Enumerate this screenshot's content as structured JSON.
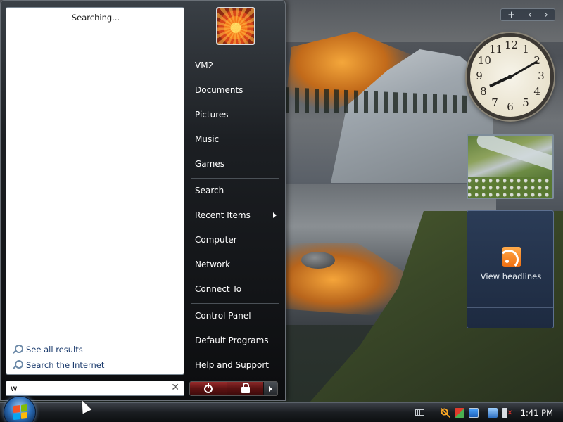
{
  "start_menu": {
    "search_status": "Searching...",
    "search_links": [
      {
        "label": "See all results",
        "icon": "search-icon"
      },
      {
        "label": "Search the Internet",
        "icon": "search-icon"
      }
    ],
    "search_query": "w",
    "user_picture": "flower-user-picture",
    "right_items": [
      {
        "label": "VM2"
      },
      {
        "label": "Documents"
      },
      {
        "label": "Pictures"
      },
      {
        "label": "Music"
      },
      {
        "label": "Games"
      },
      {
        "label": "Search"
      },
      {
        "label": "Recent Items",
        "has_submenu": true
      },
      {
        "label": "Computer"
      },
      {
        "label": "Network"
      },
      {
        "label": "Connect To"
      },
      {
        "label": "Control Panel"
      },
      {
        "label": "Default Programs"
      },
      {
        "label": "Help and Support"
      }
    ],
    "power_buttons": [
      "power-icon",
      "lock-icon",
      "arrow-right-icon"
    ]
  },
  "sidebar": {
    "controls": [
      "+",
      "‹",
      "›"
    ],
    "clock_numbers": [
      "12",
      "1",
      "2",
      "3",
      "4",
      "5",
      "6",
      "7",
      "8",
      "9",
      "10",
      "11"
    ],
    "clock_time": {
      "hour": 8,
      "minute": 10
    },
    "feed_label": "View headlines"
  },
  "taskbar": {
    "time": "1:41 PM",
    "tray_icons": [
      "keyboard-icon",
      "search-icon",
      "security-icon",
      "network-icon",
      "display-icon",
      "volume-muted-icon"
    ]
  },
  "colors": {
    "accent_blue": "#2a6bb5",
    "power_red": "#9b2b2b",
    "feed_orange": "#f06f12",
    "search_link": "#1c3c6e"
  }
}
